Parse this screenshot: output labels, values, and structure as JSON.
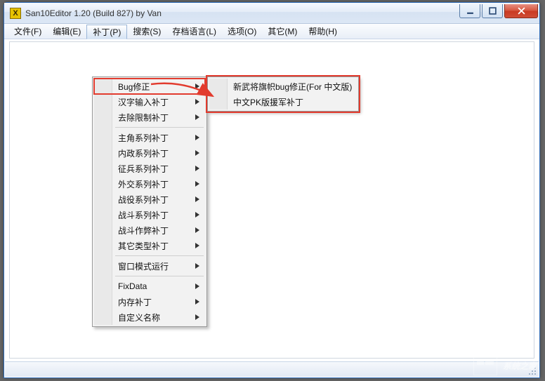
{
  "titlebar": {
    "icon_letter": "X",
    "title": "San10Editor 1.20 (Build 827) by Van"
  },
  "menubar": {
    "items": [
      {
        "label": "文件(F)",
        "open": false
      },
      {
        "label": "编辑(E)",
        "open": false
      },
      {
        "label": "补丁(P)",
        "open": true
      },
      {
        "label": "搜索(S)",
        "open": false
      },
      {
        "label": "存档语言(L)",
        "open": false
      },
      {
        "label": "选项(O)",
        "open": false
      },
      {
        "label": "其它(M)",
        "open": false
      },
      {
        "label": "帮助(H)",
        "open": false
      }
    ]
  },
  "menu1": {
    "items": [
      {
        "label": "Bug修正",
        "submenu": true,
        "highlight": true
      },
      {
        "label": "汉字输入补丁",
        "submenu": true
      },
      {
        "label": "去除限制补丁",
        "submenu": true
      },
      {
        "sep": true
      },
      {
        "label": "主角系列补丁",
        "submenu": true
      },
      {
        "label": "内政系列补丁",
        "submenu": true
      },
      {
        "label": "征兵系列补丁",
        "submenu": true
      },
      {
        "label": "外交系列补丁",
        "submenu": true
      },
      {
        "label": "战役系列补丁",
        "submenu": true
      },
      {
        "label": "战斗系列补丁",
        "submenu": true
      },
      {
        "label": "战斗作弊补丁",
        "submenu": true
      },
      {
        "label": "其它类型补丁",
        "submenu": true
      },
      {
        "sep": true
      },
      {
        "label": "窗口模式运行",
        "submenu": true
      },
      {
        "sep": true
      },
      {
        "label": "FixData",
        "submenu": true
      },
      {
        "label": "内存补丁",
        "submenu": true
      },
      {
        "label": "自定义名称",
        "submenu": true
      }
    ]
  },
  "menu2": {
    "items": [
      {
        "label": "新武将旗帜bug修正(For 中文版)"
      },
      {
        "label": "中文PK版援军补丁"
      }
    ]
  },
  "watermark": {
    "text": "系统之家"
  }
}
